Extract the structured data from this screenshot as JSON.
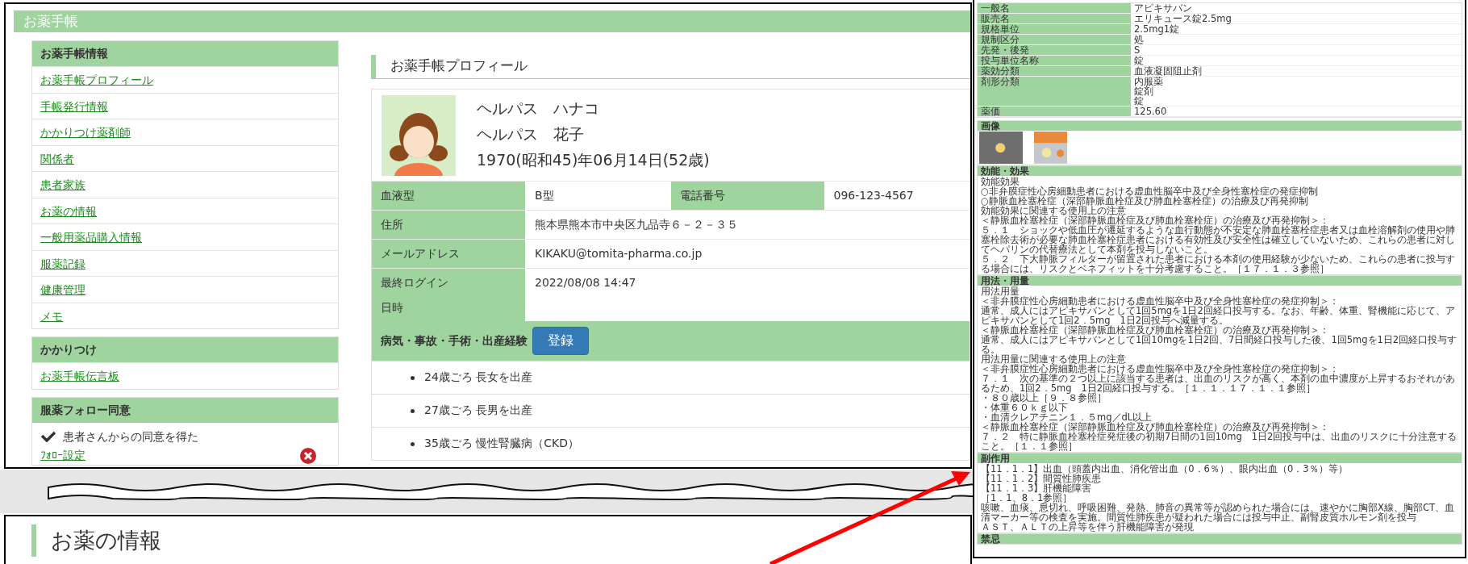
{
  "top_screen": {
    "header_title": "お薬手帳",
    "sidebar": [
      {
        "heading": "お薬手帳情報",
        "items": [
          "お薬手帳プロフィール",
          "手帳発行情報",
          "かかりつけ薬剤師",
          "関係者",
          "患者家族",
          "お薬の情報",
          "一般用薬品購入情報",
          "服薬記録",
          "健康管理",
          "メモ"
        ]
      },
      {
        "heading": "かかりつけ",
        "items": [
          "お薬手帳伝言板"
        ]
      },
      {
        "heading": "服薬フォロー同意",
        "consent": {
          "checked": true,
          "text": "患者さんからの同意を得た",
          "link": "ﾌｫﾛｰ設定"
        }
      }
    ],
    "profile": {
      "title": "お薬手帳プロフィール",
      "name_kana": "ヘルパス　ハナコ",
      "name": "ヘルパス　花子",
      "birth": "1970(昭和45)年06月14日(52歳)",
      "rows": [
        [
          {
            "label": "血液型",
            "value": "B型"
          },
          {
            "label": "電話番号",
            "value": "096-123-4567"
          }
        ],
        [
          {
            "label": "住所",
            "value": "熊本県熊本市中央区九品寺６－２－３５"
          }
        ],
        [
          {
            "label": "メールアドレス",
            "value": "KIKAKU@tomita-pharma.co.jp"
          }
        ],
        [
          {
            "label": [
              "最終ログイン",
              "日時"
            ],
            "value": "2022/08/08 14:47"
          }
        ]
      ],
      "history": {
        "label": "病気・事故・手術・出産経験",
        "button": "登録",
        "items": [
          "24歳ごろ 長女を出産",
          "27歳ごろ 長男を出産",
          "35歳ごろ 慢性腎臓病（CKD）"
        ]
      }
    }
  },
  "bottom_screen": {
    "title": "お薬の情報"
  },
  "drug_panel": {
    "rows": [
      {
        "label": "一般名",
        "value": "アピキサバン"
      },
      {
        "label": "販売名",
        "value": "エリキュース錠2.5mg"
      },
      {
        "label": "規格単位",
        "value": "2.5mg1錠"
      },
      {
        "label": "規制区分",
        "value": "処"
      },
      {
        "label": "先発・後発",
        "value": "S"
      },
      {
        "label": "投与単位名称",
        "value": "錠"
      },
      {
        "label": "薬効分類",
        "value": "血液凝固阻止剤"
      },
      {
        "label": "剤形分類",
        "value": [
          "内服薬",
          "錠剤",
          "錠"
        ]
      },
      {
        "label": "薬価",
        "value": "125.60"
      }
    ],
    "sections": [
      {
        "heading": "画像",
        "kind": "images",
        "photos": [
          {
            "kind": "tablet"
          },
          {
            "kind": "package"
          }
        ]
      },
      {
        "heading": "効能・効果",
        "kind": "text",
        "lines": [
          "効能効果",
          "○非弁膜症性心房細動患者における虚血性脳卒中及び全身性塞栓症の発症抑制",
          "○静脈血栓塞栓症（深部静脈血栓症及び肺血栓塞栓症）の治療及び再発抑制",
          "効能効果に関連する使用上の注意",
          "＜静脈血栓塞栓症（深部静脈血栓症及び肺血栓塞栓症）の治療及び再発抑制＞：",
          "５．１　ショックや低血圧が遷延するような血行動態が不安定な肺血栓塞栓症患者又は血栓溶解剤の使用や肺塞栓除去術が必要な肺血栓塞栓症患者における有効性及び安全性は確立していないため、これらの患者に対してヘパリンの代替療法として本剤を投与しないこと。",
          "５．２　下大静脈フィルターが留置された患者における本剤の使用経験が少ないため、これらの患者に投与する場合には、リスクとベネフィットを十分考慮すること。［１７．１．３参照］"
        ]
      },
      {
        "heading": "用法・用量",
        "kind": "text",
        "lines": [
          "用法用量",
          "＜非弁膜症性心房細動患者における虚血性脳卒中及び全身性塞栓症の発症抑制＞：",
          "通常、成人にはアピキサバンとして1回5mgを1日2回経口投与する。なお、年齢、体重、腎機能に応じて、アピキサバンとして1回2．5mg　1日2回投与へ減量する。",
          "＜静脈血栓塞栓症（深部静脈血栓症及び肺血栓塞栓症）の治療及び再発抑制＞：",
          "通常、成人にはアピキサバンとして1回10mgを1日2回、7日間経口投与した後、1回5mgを1日2回経口投与する。",
          "用法用量に関連する使用上の注意",
          "＜非弁膜症性心房細動患者における虚血性脳卒中及び全身性塞栓症の発症抑制＞：",
          "７．１　次の基準の２つ以上に該当する患者は、出血のリスクが高く、本剤の血中濃度が上昇するおそれがあるため、1回2．5mg　1日2回経口投与する。［１．１．１７．１．１参照］",
          "・８０歳以上［９．８参照］",
          "・体重６０ｋｇ以下",
          "・血清クレアチニン１．５mg／dL以上",
          "＜静脈血栓塞栓症（深部静脈血栓症及び肺血栓塞栓症）の治療及び再発抑制＞：",
          "７．２　特に静脈血栓塞栓症発症後の初期7日間の1回10mg　1日2回投与中は、出血のリスクに十分注意すること。［１．１参照］"
        ]
      },
      {
        "heading": "副作用",
        "kind": "text",
        "lines": [
          "【11．1．1】出血（頭蓋内出血、消化管出血（0．6％）、眼内出血（0．3％）等）",
          "【11．1．2】間質性肺疾患",
          "【11．1．3】肝機能障害",
          "［1．1、8．1参照］",
          "咳嗽、血痰、息切れ、呼吸困難、発熱、肺音の異常等が認められた場合には、速やかに胸部X線、胸部CT、血清マーカー等の検査を実施。間質性肺疾患が疑われた場合には投与中止、副腎皮質ホルモン剤を投与",
          "ＡＳＴ、ＡＬＴの上昇等を伴う肝機能障害が発現"
        ]
      },
      {
        "heading": "禁忌",
        "kind": "text"
      }
    ]
  }
}
